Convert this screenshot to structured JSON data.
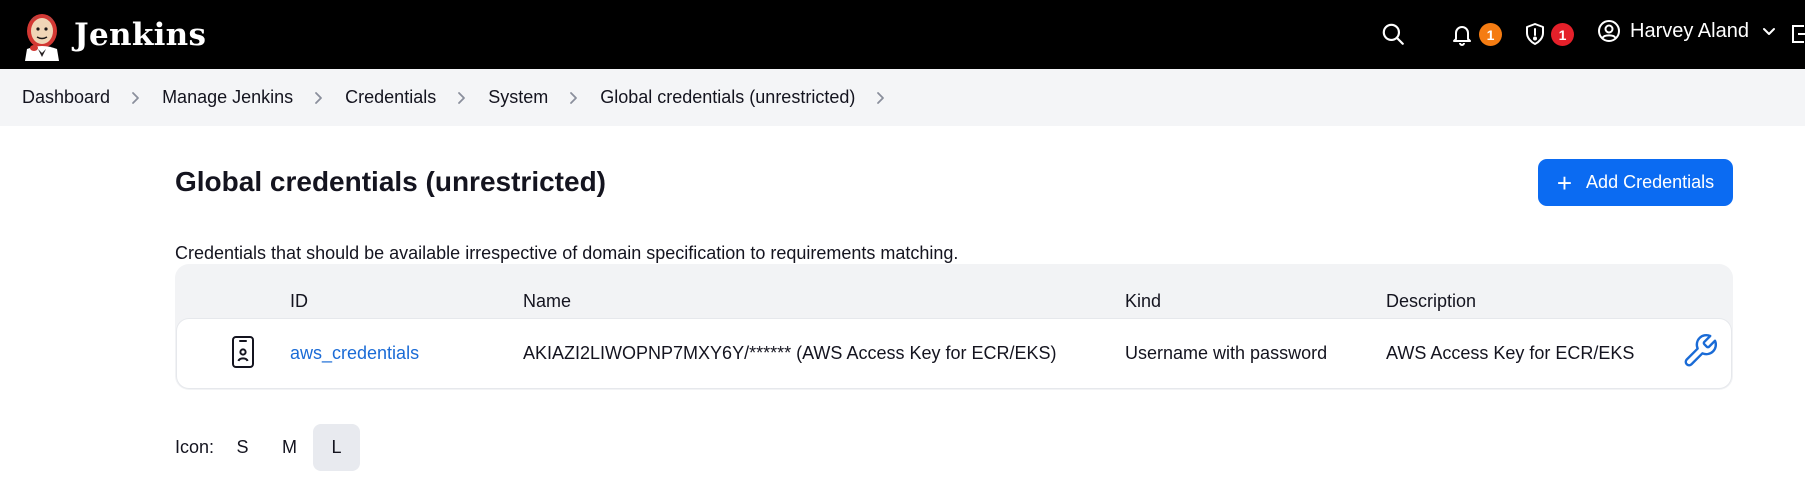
{
  "app": {
    "name": "Jenkins"
  },
  "header": {
    "notifications_count": "1",
    "security_count": "1",
    "user_name": "Harvey Aland",
    "colors": {
      "notification_badge": "#f57c12",
      "security_badge": "#e5202a"
    }
  },
  "breadcrumb": [
    "Dashboard",
    "Manage Jenkins",
    "Credentials",
    "System",
    "Global credentials (unrestricted)"
  ],
  "page": {
    "title": "Global credentials (unrestricted)",
    "add_button_label": "Add Credentials",
    "description": "Credentials that should be available irrespective of domain specification to requirements matching."
  },
  "table": {
    "columns": [
      "ID",
      "Name",
      "Kind",
      "Description"
    ],
    "rows": [
      {
        "id": "aws_credentials",
        "name": "AKIAZI2LIWOPNP7MXY6Y/****** (AWS Access Key for ECR/EKS)",
        "kind": "Username with password",
        "description": "AWS Access Key for ECR/EKS"
      }
    ]
  },
  "icon_size": {
    "label": "Icon:",
    "options": [
      "S",
      "M",
      "L"
    ],
    "selected": "L"
  },
  "accent_color": "#0b6bf2"
}
